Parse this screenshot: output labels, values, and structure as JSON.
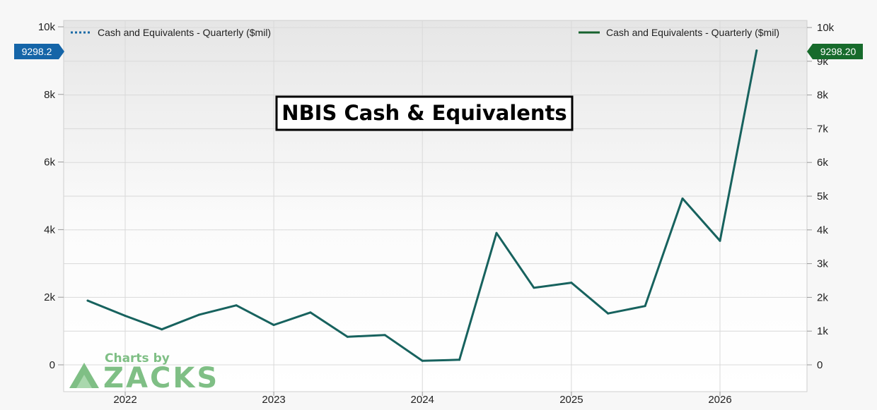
{
  "chart_data": {
    "type": "line",
    "title": "NBIS Cash & Equivalents",
    "xlabel": "",
    "ylabel": "",
    "x": [
      "2021-10-01",
      "2022-01-01",
      "2022-04-01",
      "2022-07-01",
      "2022-10-01",
      "2023-01-01",
      "2023-04-01",
      "2023-07-01",
      "2023-10-01",
      "2024-01-01",
      "2024-04-01",
      "2024-07-01",
      "2024-10-01",
      "2025-01-01",
      "2025-04-01",
      "2025-07-01",
      "2025-10-01",
      "2026-01-01",
      "2026-04-01"
    ],
    "series": [
      {
        "name": "Cash and Equivalents - Quarterly ($mil)",
        "values": [
          1900,
          1450,
          1050,
          1480,
          1760,
          1180,
          1550,
          830,
          880,
          120,
          150,
          3900,
          2280,
          2430,
          1520,
          1740,
          4920,
          3670,
          9298.2
        ]
      }
    ],
    "x_ticks": [
      "2022",
      "2023",
      "2024",
      "2025",
      "2026"
    ],
    "y_left_ticks": [
      "0",
      "2k",
      "4k",
      "6k",
      "8k",
      "10k"
    ],
    "y_right_ticks": [
      "0",
      "1k",
      "2k",
      "3k",
      "4k",
      "5k",
      "6k",
      "7k",
      "8k",
      "9k",
      "10k"
    ],
    "ylim": [
      -800,
      10000
    ],
    "grid": true,
    "legend_left": "Cash and Equivalents - Quarterly ($mil)",
    "legend_right": "Cash and Equivalents - Quarterly ($mil)",
    "badge_left": "9298.2",
    "badge_right": "9298.20",
    "watermark_top": "Charts by",
    "watermark_brand": "ZACKS",
    "colors": {
      "line": "#17625e",
      "legend_left_line": "#1a6aa6",
      "legend_right_line": "#17622e",
      "badge_left": "#1565a8",
      "badge_right": "#176b2c",
      "watermark": "#7fbf85"
    }
  }
}
